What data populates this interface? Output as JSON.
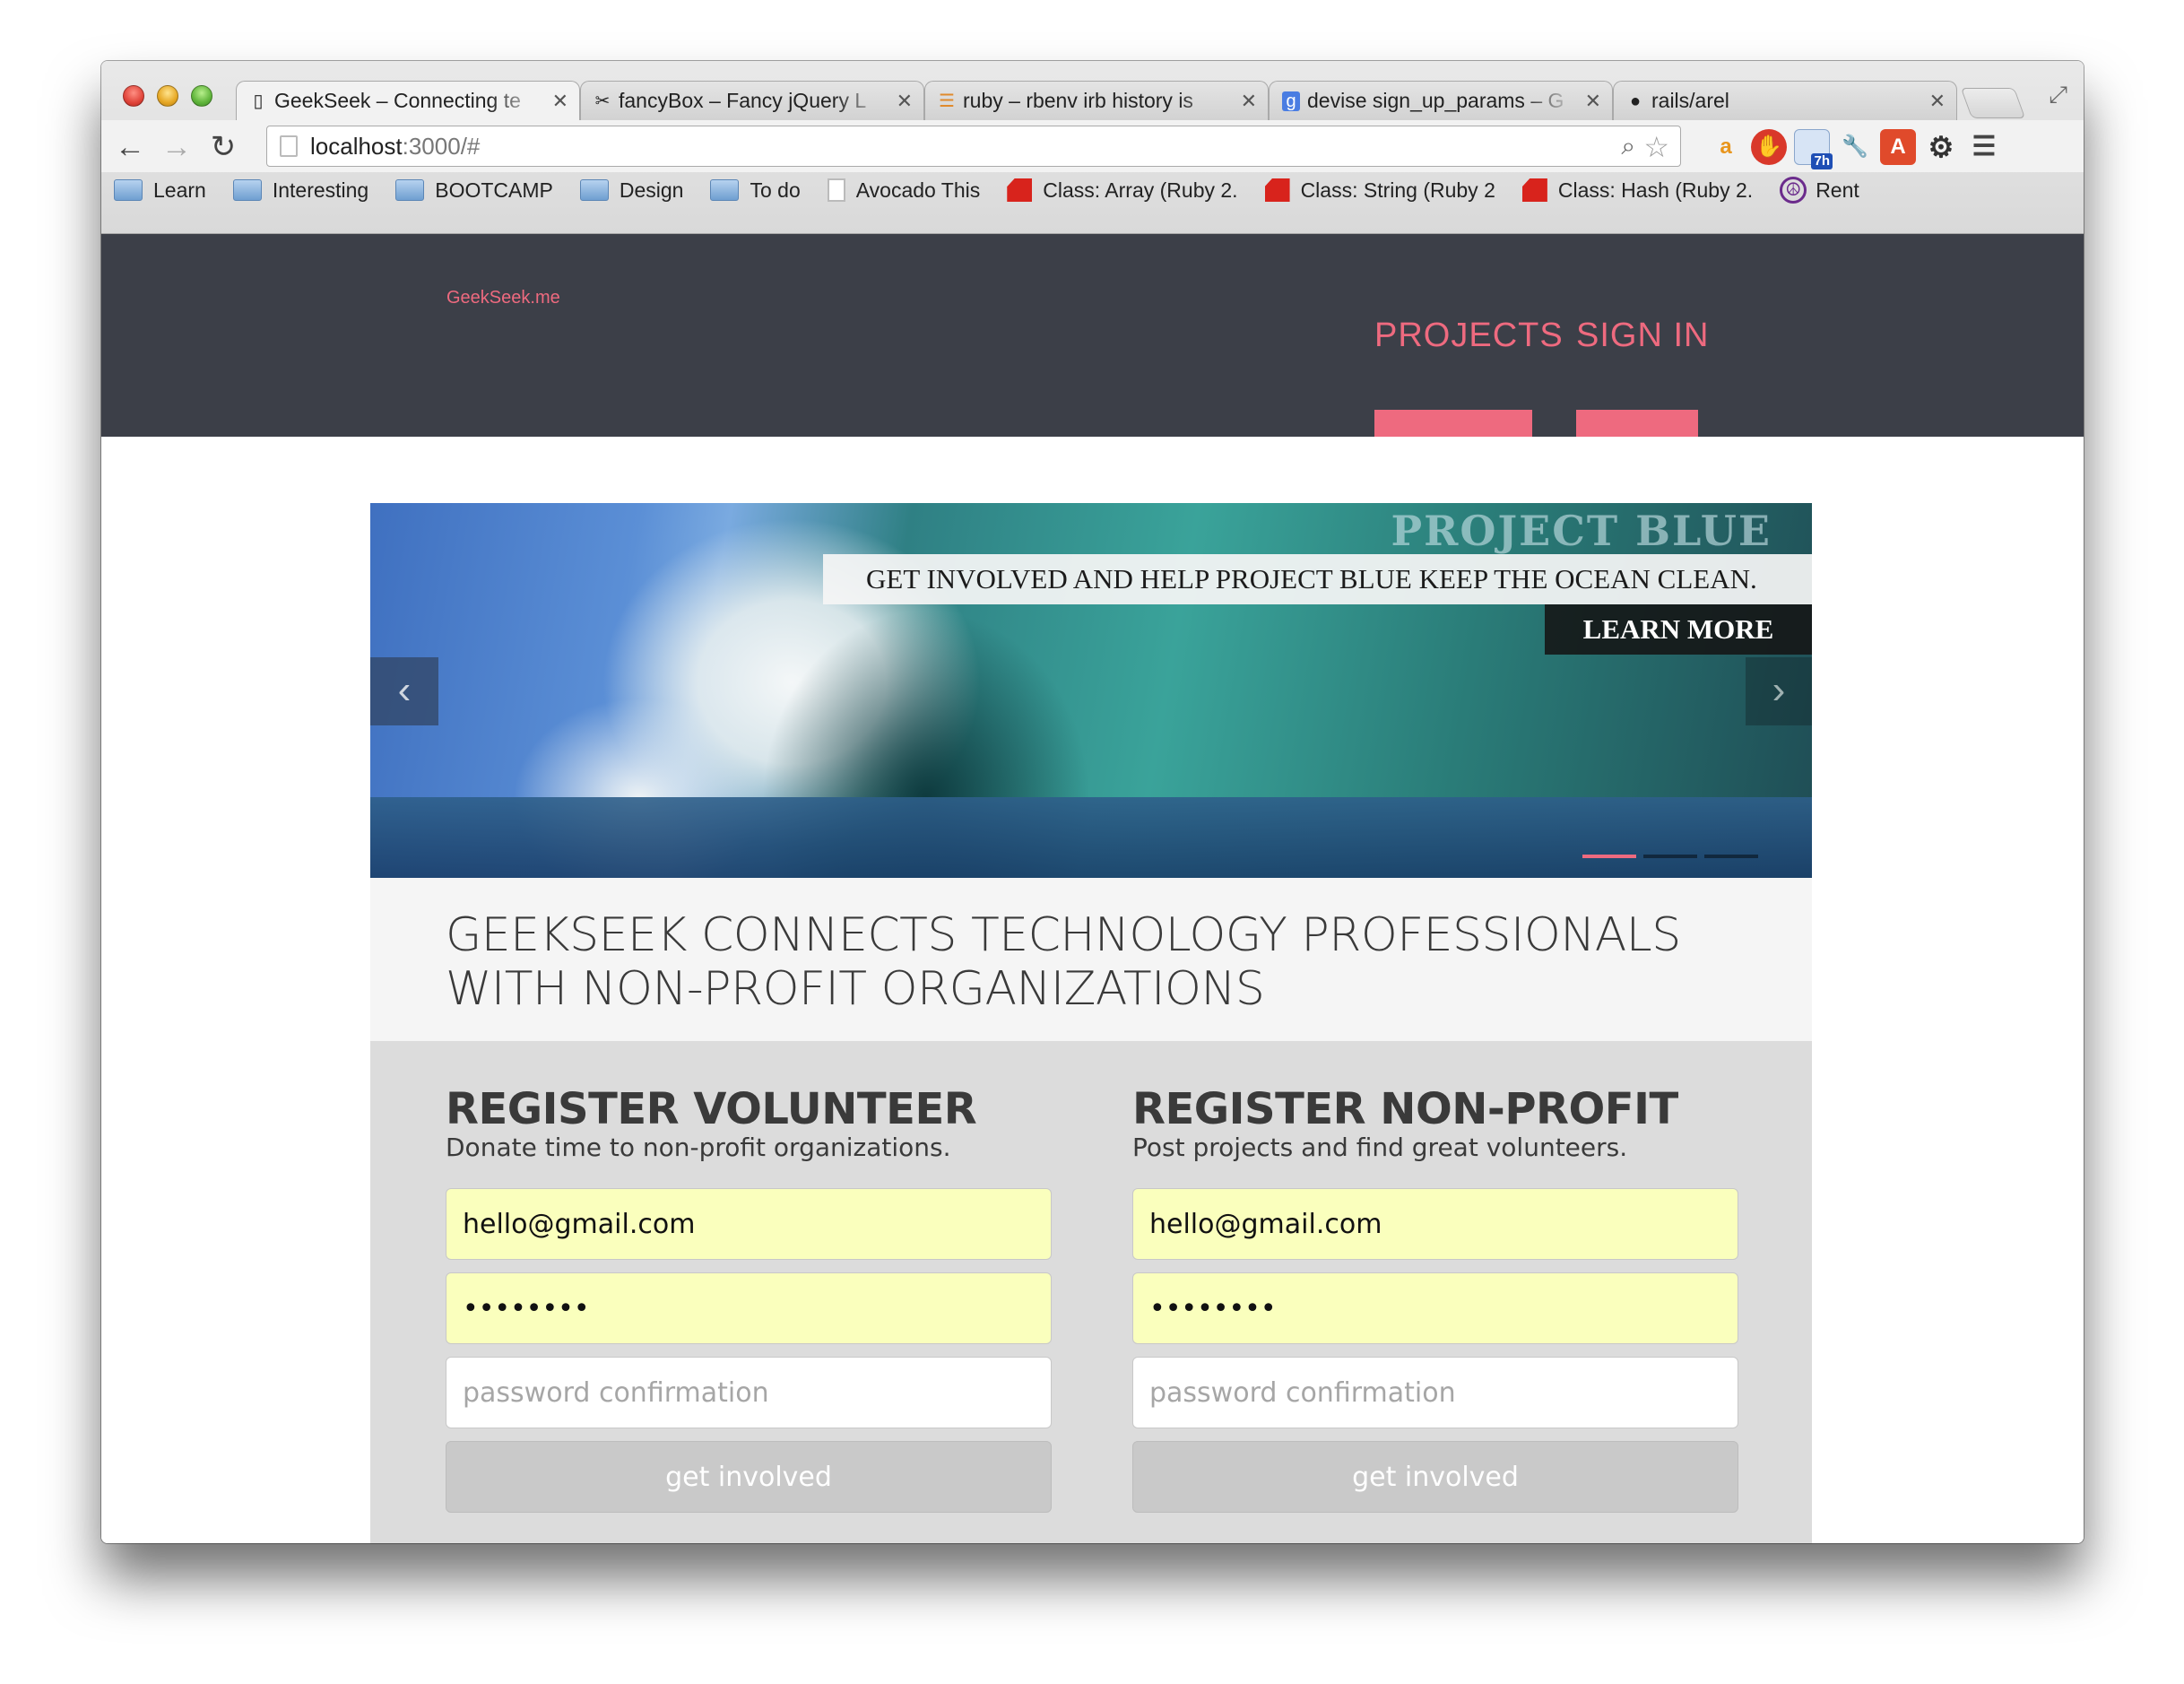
{
  "browser": {
    "tabs": [
      {
        "title": "GeekSeek – Connecting te",
        "icon": "page-icon"
      },
      {
        "title": "fancyBox – Fancy jQuery L",
        "icon": "fancybox-icon"
      },
      {
        "title": "ruby – rbenv irb history is",
        "icon": "stackoverflow-icon"
      },
      {
        "title": "devise sign_up_params – G",
        "icon": "google-icon"
      },
      {
        "title": "rails/arel",
        "icon": "github-icon"
      }
    ],
    "address": {
      "host": "localhost",
      "rest": ":3000/#"
    },
    "bookmarks": [
      {
        "label": "Learn",
        "icon": "folder"
      },
      {
        "label": "Interesting",
        "icon": "folder"
      },
      {
        "label": "BOOTCAMP",
        "icon": "folder"
      },
      {
        "label": "Design",
        "icon": "folder"
      },
      {
        "label": "To do",
        "icon": "folder"
      },
      {
        "label": "Avocado This",
        "icon": "doc"
      },
      {
        "label": "Class: Array (Ruby 2.",
        "icon": "ruby"
      },
      {
        "label": "Class: String (Ruby 2",
        "icon": "ruby"
      },
      {
        "label": "Class: Hash (Ruby 2.",
        "icon": "ruby"
      },
      {
        "label": "Rent",
        "icon": "peace"
      }
    ],
    "extensions": {
      "calendar_badge": "7h"
    }
  },
  "site": {
    "logo": "GeekSeek.me",
    "nav": {
      "projects": "PROJECTS",
      "signin": "SIGN IN"
    },
    "hero": {
      "watermark": "PROJECT BLUE",
      "caption": "GET INVOLVED AND HELP PROJECT BLUE KEEP THE OCEAN CLEAN.",
      "cta": "LEARN MORE",
      "prev": "‹",
      "next": "›"
    },
    "tagline": "GEEKSEEK CONNECTS TECHNOLOGY PROFESSIONALS WITH NON-PROFIT ORGANIZATIONS",
    "volunteer": {
      "title": "REGISTER VOLUNTEER",
      "subtitle": "Donate time to non-profit organizations.",
      "email": "hello@gmail.com",
      "password": "password",
      "confirm_placeholder": "password confirmation",
      "submit": "get involved"
    },
    "nonprofit": {
      "title": "REGISTER NON-PROFIT",
      "subtitle": "Post projects and find great volunteers.",
      "email": "hello@gmail.com",
      "password": "password",
      "confirm_placeholder": "password confirmation",
      "submit": "get involved"
    }
  },
  "colors": {
    "accent": "#ee6a7f",
    "header_bg": "#3c3f48",
    "autofill": "#faffbd"
  }
}
